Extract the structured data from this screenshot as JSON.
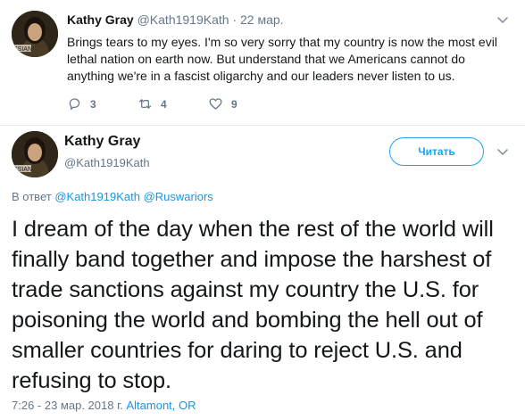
{
  "reply_tweet": {
    "name": "Kathy Gray",
    "handle": "@Kath1919Kath",
    "separator": "·",
    "date": "22 мар.",
    "text": "Brings tears to my eyes. I'm so very sorry that my country is now the most evil lethal nation on earth now. But understand that we Americans cannot do anything we're in a fascist oligarchy and our leaders never listen to us.",
    "reply_count": "3",
    "retweet_count": "4",
    "like_count": "9"
  },
  "main_tweet": {
    "name": "Kathy Gray",
    "handle": "@Kath1919Kath",
    "follow_label": "Читать",
    "reply_prefix": "В ответ",
    "reply_user_1": "@Kath1919Kath",
    "reply_user_2": "@Ruswariors",
    "text": "I dream of the day when the rest of the world will finally band together and impose the harshest of trade sanctions against my country the U.S. for poisoning the world and bombing the hell out of smaller countries for daring to reject U.S. and refusing to stop.",
    "timestamp": "7:26 - 23 мар. 2018 г.",
    "location": "Altamont, OR"
  },
  "avatar_badge_text": "SSIAN",
  "colors": {
    "link": "#1b95e0",
    "accent": "#1da1f2",
    "muted": "#657786",
    "text": "#14171a",
    "divider": "#e6ecf0"
  },
  "icons": [
    "caret-down-icon",
    "reply-icon",
    "retweet-icon",
    "like-icon"
  ]
}
